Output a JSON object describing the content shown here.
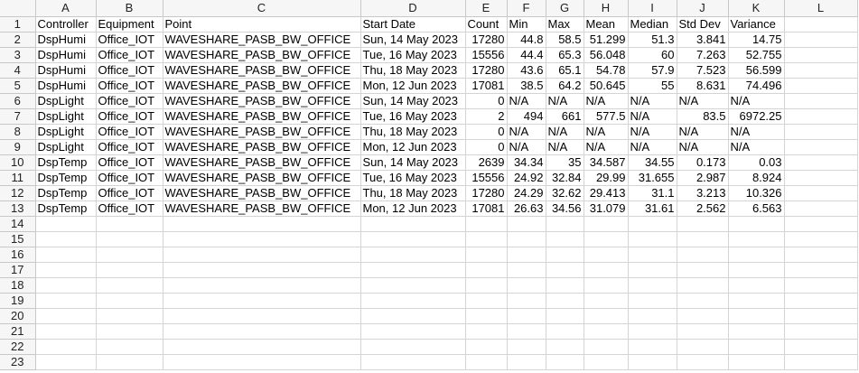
{
  "columns": [
    "A",
    "B",
    "C",
    "D",
    "E",
    "F",
    "G",
    "H",
    "I",
    "J",
    "K",
    "L"
  ],
  "header_row": [
    "Controller",
    "Equipment",
    "Point",
    "Start Date",
    "Count",
    "Min",
    "Max",
    "Mean",
    "Median",
    "Std Dev",
    "Variance",
    ""
  ],
  "rows": [
    [
      "DspHumi",
      "Office_IOT",
      "WAVESHARE_PASB_BW_OFFICE",
      "Sun, 14 May 2023",
      "17280",
      "44.8",
      "58.5",
      "51.299",
      "51.3",
      "3.841",
      "14.75"
    ],
    [
      "DspHumi",
      "Office_IOT",
      "WAVESHARE_PASB_BW_OFFICE",
      "Tue, 16 May 2023",
      "15556",
      "44.4",
      "65.3",
      "56.048",
      "60",
      "7.263",
      "52.755"
    ],
    [
      "DspHumi",
      "Office_IOT",
      "WAVESHARE_PASB_BW_OFFICE",
      "Thu, 18 May 2023",
      "17280",
      "43.6",
      "65.1",
      "54.78",
      "57.9",
      "7.523",
      "56.599"
    ],
    [
      "DspHumi",
      "Office_IOT",
      "WAVESHARE_PASB_BW_OFFICE",
      "Mon, 12 Jun 2023",
      "17081",
      "38.5",
      "64.2",
      "50.645",
      "55",
      "8.631",
      "74.496"
    ],
    [
      "DspLight",
      "Office_IOT",
      "WAVESHARE_PASB_BW_OFFICE",
      "Sun, 14 May 2023",
      "0",
      "N/A",
      "N/A",
      "N/A",
      "N/A",
      "N/A",
      "N/A"
    ],
    [
      "DspLight",
      "Office_IOT",
      "WAVESHARE_PASB_BW_OFFICE",
      "Tue, 16 May 2023",
      "2",
      "494",
      "661",
      "577.5",
      "N/A",
      "83.5",
      "6972.25"
    ],
    [
      "DspLight",
      "Office_IOT",
      "WAVESHARE_PASB_BW_OFFICE",
      "Thu, 18 May 2023",
      "0",
      "N/A",
      "N/A",
      "N/A",
      "N/A",
      "N/A",
      "N/A"
    ],
    [
      "DspLight",
      "Office_IOT",
      "WAVESHARE_PASB_BW_OFFICE",
      "Mon, 12 Jun 2023",
      "0",
      "N/A",
      "N/A",
      "N/A",
      "N/A",
      "N/A",
      "N/A"
    ],
    [
      "DspTemp",
      "Office_IOT",
      "WAVESHARE_PASB_BW_OFFICE",
      "Sun, 14 May 2023",
      "2639",
      "34.34",
      "35",
      "34.587",
      "34.55",
      "0.173",
      "0.03"
    ],
    [
      "DspTemp",
      "Office_IOT",
      "WAVESHARE_PASB_BW_OFFICE",
      "Tue, 16 May 2023",
      "15556",
      "24.92",
      "32.84",
      "29.99",
      "31.655",
      "2.987",
      "8.924"
    ],
    [
      "DspTemp",
      "Office_IOT",
      "WAVESHARE_PASB_BW_OFFICE",
      "Thu, 18 May 2023",
      "17280",
      "24.29",
      "32.62",
      "29.413",
      "31.1",
      "3.213",
      "10.326"
    ],
    [
      "DspTemp",
      "Office_IOT",
      "WAVESHARE_PASB_BW_OFFICE",
      "Mon, 12 Jun 2023",
      "17081",
      "26.63",
      "34.56",
      "31.079",
      "31.61",
      "2.562",
      "6.563"
    ]
  ],
  "total_rows": 23
}
